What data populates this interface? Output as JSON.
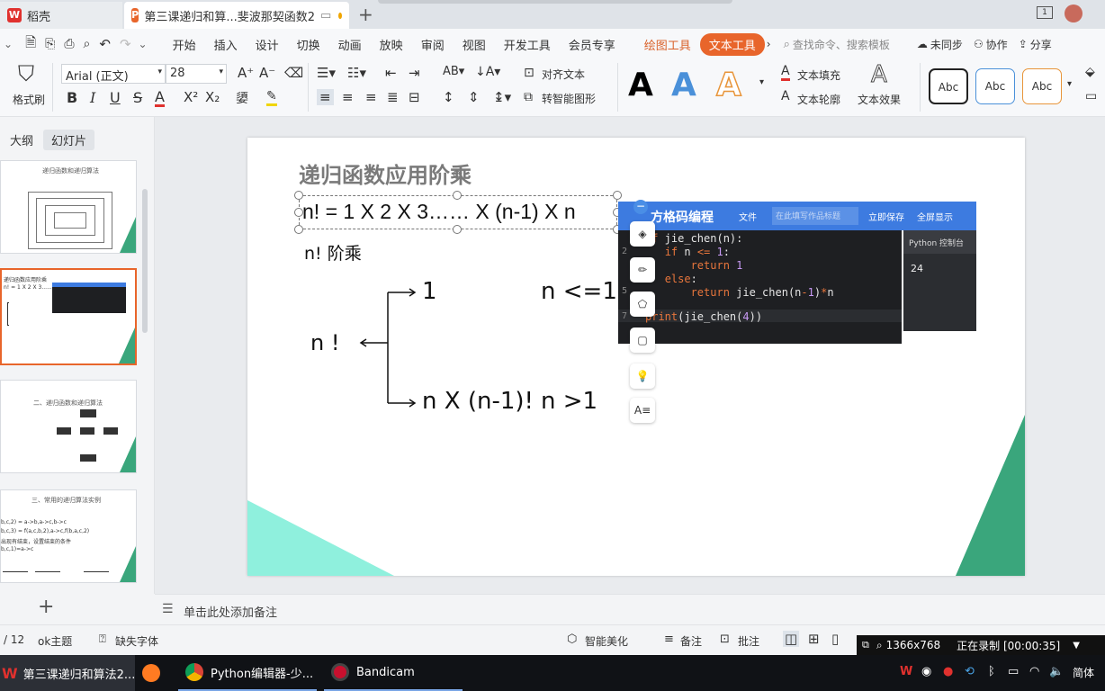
{
  "titlebar": {
    "tab1": "稻壳",
    "tab2": "第三课递归和算...斐波那契函数2",
    "new_tab": "+"
  },
  "menubar": {
    "items": [
      "开始",
      "插入",
      "设计",
      "切换",
      "动画",
      "放映",
      "审阅",
      "视图",
      "开发工具",
      "会员专享"
    ],
    "draw_tools": "绘图工具",
    "text_tools": "文本工具",
    "search": "查找命令、搜索模板",
    "sync": "未同步",
    "collab": "协作",
    "share": "分享"
  },
  "ribbon": {
    "format_painter": "格式刷",
    "font_name": "Arial (正文)",
    "font_size": "28",
    "align_text": "对齐文本",
    "smart_shape": "转智能图形",
    "text_fill": "文本填充",
    "text_outline": "文本轮廓",
    "text_effect": "文本效果",
    "style1": "Abc",
    "style2": "Abc",
    "style3": "Abc",
    "colors": {
      "black": "#000000",
      "blue": "#4a90d9",
      "orange": "#e8953a"
    }
  },
  "leftpanel": {
    "outline": "大纲",
    "slides": "幻灯片",
    "thumb1_title": "递归函数和递归算法",
    "thumb2_line1": "递归函数应用阶乘",
    "thumb2_line2": "n! = 1 X 2 X 3...... X (n-1) X n",
    "thumb3_title": "二、递归函数和递归算法",
    "thumb4_title": "三、常用的递归算法实例",
    "thumb4_l1": "b,c,2) = a->b,a->c,b->c",
    "thumb4_l2": "b,c,3) = f(a,c,b,2),a->c,f(b,a,c,2)",
    "thumb4_l3": "出现有结束，设置结束的条件",
    "thumb4_l4": "b,c,1)=a->c",
    "add": "+"
  },
  "slide": {
    "title": "递归函数应用阶乘",
    "formula": "n! = 1 X 2 X 3…… X (n-1) X n",
    "subtitle": "n!  阶乘",
    "left": "n !",
    "case1_val": "1",
    "case1_cond": "n <=1",
    "case2_val": "n X (n-1)!",
    "case2_cond": "n >1",
    "accent": "#3aa67c"
  },
  "codewin": {
    "brand": "方格码编程",
    "file": "文件",
    "title_placeholder": "在此填写作品标题",
    "save": "立即保存",
    "fullscreen": "全屏显示",
    "console_title": "Python 控制台",
    "console_output": "24",
    "lines": [
      {
        "n": "",
        "code": "ef jie_chen(n):"
      },
      {
        "n": "2",
        "code": "    if n <= 1:"
      },
      {
        "n": "",
        "code": "        return 1"
      },
      {
        "n": "",
        "code": "    else:"
      },
      {
        "n": "5",
        "code": "        return jie_chen(n-1)*n"
      },
      {
        "n": "7",
        "code": "print(jie_chen(4))"
      }
    ]
  },
  "notes": {
    "placeholder": "单击此处添加备注"
  },
  "statusbar": {
    "pages": "/ 12",
    "theme": "ok主题",
    "missing_font": "缺失字体",
    "smart_beautify": "智能美化",
    "notes": "备注",
    "comments": "批注"
  },
  "recording": {
    "resolution": "1366x768",
    "status": "正在录制 [00:00:35]"
  },
  "taskbar": {
    "app1": "第三课递归和算法2...",
    "app2": "Python编辑器-少...",
    "app3": "Bandicam",
    "ime": "简体"
  }
}
